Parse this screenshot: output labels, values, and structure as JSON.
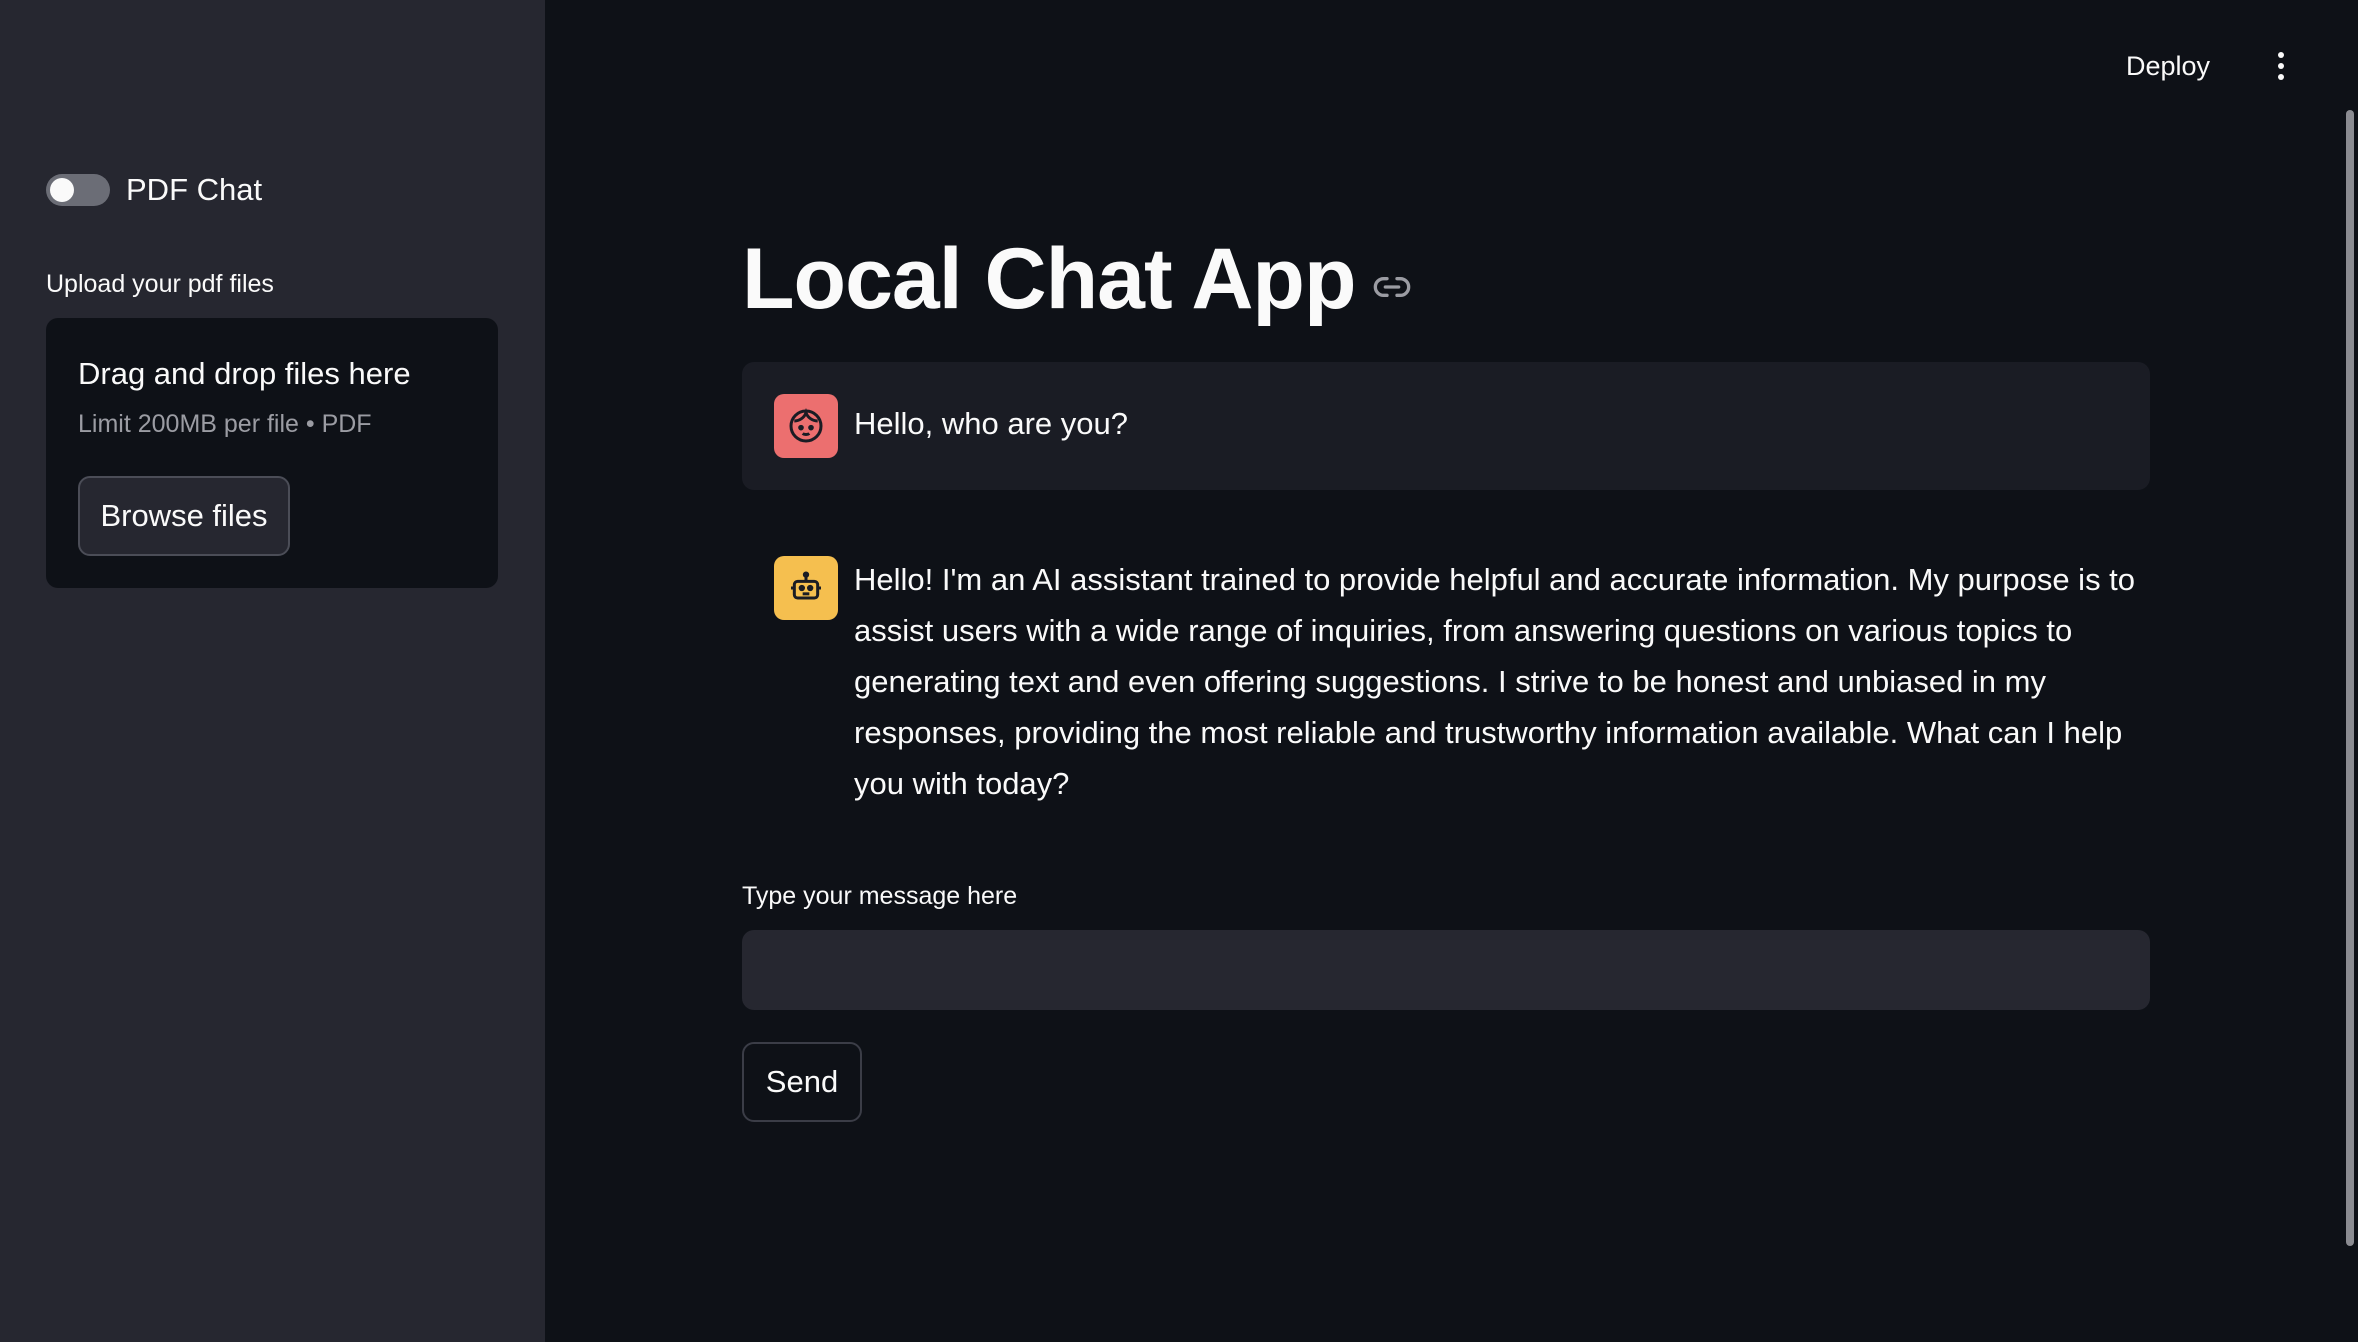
{
  "sidebar": {
    "toggle": {
      "label": "PDF Chat",
      "checked": false
    },
    "upload": {
      "label": "Upload your pdf files",
      "dropzone_title": "Drag and drop files here",
      "dropzone_subtitle": "Limit 200MB per file • PDF",
      "browse_label": "Browse files"
    }
  },
  "header": {
    "deploy_label": "Deploy",
    "menu_icon": "kebab-menu-icon"
  },
  "main": {
    "title": "Local Chat App",
    "title_icon": "link-icon",
    "messages": [
      {
        "role": "user",
        "avatar_icon": "user-face-icon",
        "avatar_color": "#ec6f6f",
        "text": "Hello, who are you?"
      },
      {
        "role": "assistant",
        "avatar_icon": "robot-icon",
        "avatar_color": "#f5bf4f",
        "text": "Hello! I'm an AI assistant trained to provide helpful and accurate information. My purpose is to assist users with a wide range of inquiries, from answering questions on various topics to generating text and even offering suggestions. I strive to be honest and unbiased in my responses, providing the most reliable and trustworthy information available. What can I help you with today?"
      }
    ],
    "input": {
      "label": "Type your message here",
      "value": "",
      "placeholder": ""
    },
    "send_label": "Send"
  },
  "colors": {
    "background": "#0e1117",
    "sidebar": "#262730",
    "user_avatar": "#ec6f6f",
    "bot_avatar": "#f5bf4f"
  }
}
